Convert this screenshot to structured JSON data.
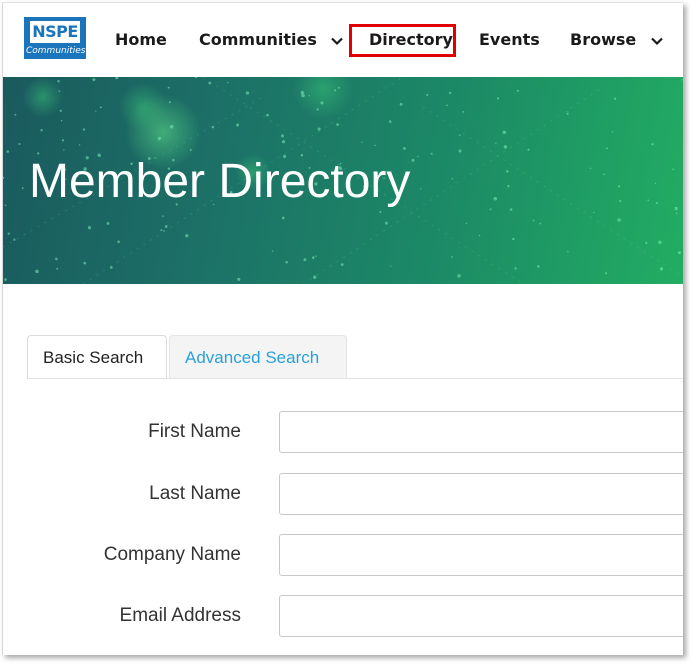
{
  "nav": {
    "logo_top": "NSPE",
    "logo_bottom": "Communities",
    "items": [
      {
        "label": "Home"
      },
      {
        "label": "Communities"
      },
      {
        "label": "Directory"
      },
      {
        "label": "Events"
      },
      {
        "label": "Browse"
      }
    ],
    "highlight_color": "#e00000"
  },
  "hero": {
    "title": "Member Directory",
    "gradient_start": "#1a5a5e",
    "gradient_end": "#22ad62"
  },
  "tabs": [
    {
      "label": "Basic Search",
      "active": true
    },
    {
      "label": "Advanced Search",
      "active": false,
      "color": "#2aa0dc"
    }
  ],
  "form": {
    "fields": [
      {
        "label": "First Name",
        "value": ""
      },
      {
        "label": "Last Name",
        "value": ""
      },
      {
        "label": "Company Name",
        "value": ""
      },
      {
        "label": "Email Address",
        "value": ""
      }
    ]
  }
}
